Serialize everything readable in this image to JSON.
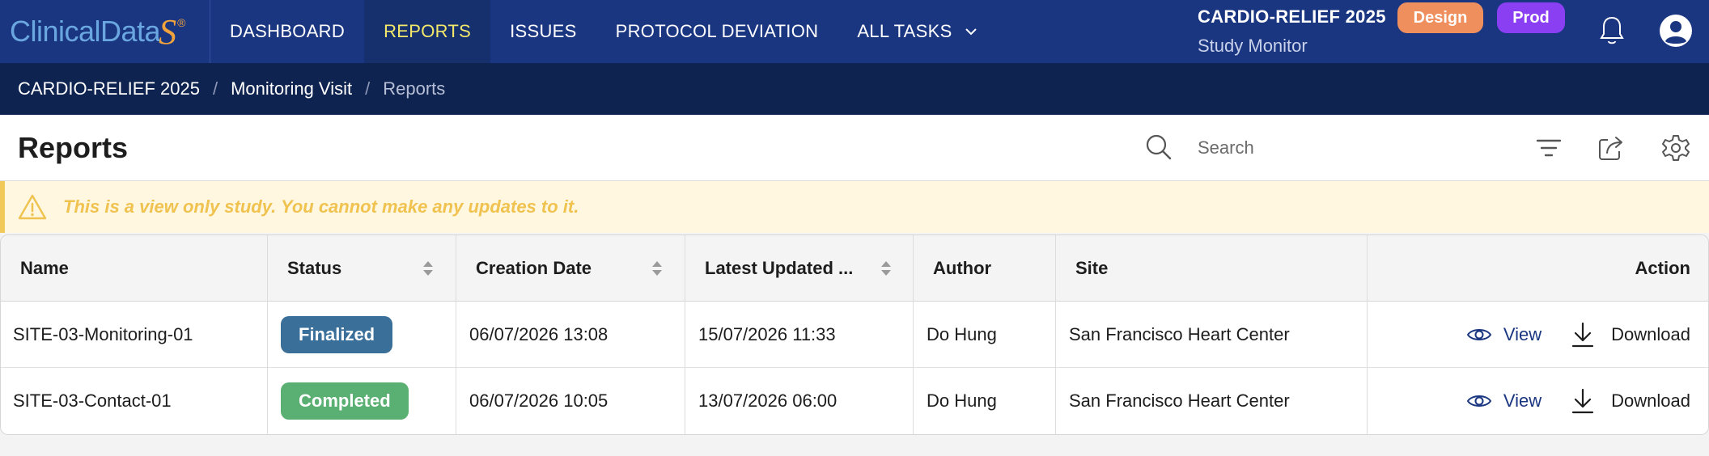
{
  "brand": {
    "logo_text": "ClinicalData",
    "logo_mark": "S",
    "logo_reg": "®"
  },
  "nav": {
    "items": [
      {
        "label": "DASHBOARD",
        "active": false
      },
      {
        "label": "REPORTS",
        "active": true
      },
      {
        "label": "ISSUES",
        "active": false
      },
      {
        "label": "PROTOCOL DEVIATION",
        "active": false
      },
      {
        "label": "ALL TASKS",
        "active": false,
        "dropdown": true
      }
    ]
  },
  "study": {
    "name": "CARDIO-RELIEF 2025",
    "role": "Study Monitor",
    "badge_design": "Design",
    "badge_prod": "Prod"
  },
  "breadcrumb": [
    "CARDIO-RELIEF 2025",
    "Monitoring Visit",
    "Reports"
  ],
  "breadcrumb_sep": "/",
  "header": {
    "title": "Reports",
    "search_placeholder": "Search"
  },
  "warning": {
    "text": "This is a view only study. You cannot make any updates to it."
  },
  "table": {
    "columns": [
      "Name",
      "Status",
      "Creation Date",
      "Latest Updated ...",
      "Author",
      "Site",
      "Action"
    ],
    "rows": [
      {
        "name": "SITE-03-Monitoring-01",
        "status": "Finalized",
        "created": "06/07/2026 13:08",
        "updated": "15/07/2026 11:33",
        "author": "Do Hung",
        "site": "San Francisco Heart Center",
        "view": "View",
        "download": "Download"
      },
      {
        "name": "SITE-03-Contact-01",
        "status": "Completed",
        "created": "06/07/2026 10:05",
        "updated": "13/07/2026 06:00",
        "author": "Do Hung",
        "site": "San Francisco Heart Center",
        "view": "View",
        "download": "Download"
      }
    ]
  },
  "colors": {
    "nav_bg": "#1a3680",
    "active_text": "#f3e86a",
    "finalized": "#3a6f9a",
    "completed": "#5aaf72",
    "design_badge": "#ef8f5e",
    "prod_badge": "#8b3ff2",
    "warning_text": "#f0c24f"
  },
  "icons": {
    "search": "search-icon",
    "filter": "filter-icon",
    "export": "export-icon",
    "settings": "gear-icon",
    "bell": "bell-icon",
    "user": "user-avatar-icon",
    "warning": "warning-icon",
    "view": "eye-icon",
    "download": "download-icon",
    "sort": "sort-icon",
    "chevron": "chevron-down-icon"
  }
}
